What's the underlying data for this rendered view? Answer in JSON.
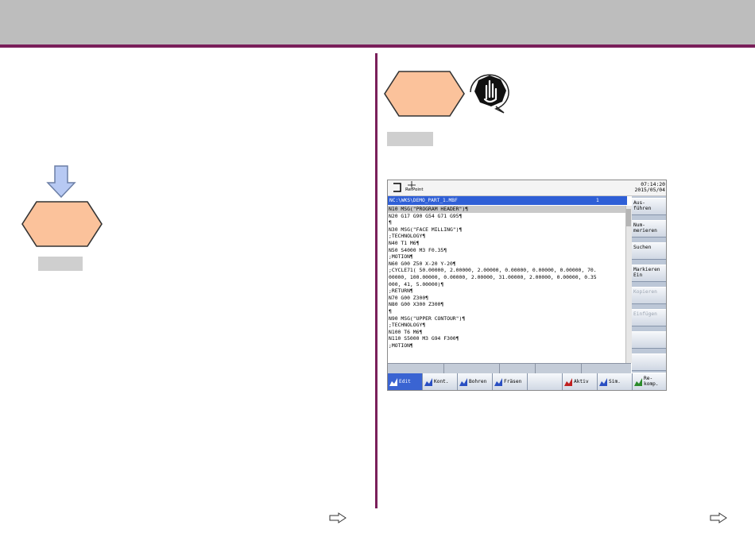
{
  "colors": {
    "header_bar": "#bdbdbd",
    "accent_line": "#7a1f5a",
    "hexagon_fill": "#fbc29b",
    "arrow_fill": "#b7c9f3",
    "gray_box": "#cfcfcf",
    "selection_blue": "#2f5fd6"
  },
  "icons": {
    "down_arrow": "down-arrow-icon",
    "hexagon_left": "hexagon-icon",
    "hexagon_right": "hexagon-icon",
    "warning": "pointing-hand-warning-icon",
    "next_page_left": "right-arrow-icon",
    "next_page_right": "right-arrow-icon"
  },
  "cnc": {
    "time": "07:14:20",
    "date": "2015/05/04",
    "refpoint": "RefPoint",
    "path": "NC:\\WKS\\DEMO_PART_1.MBF",
    "path_num": "1",
    "code_lines": [
      "N10 MSG(\"PROGRAM HEADER\")¶",
      "N20 G17 G90 G54 G71 G95¶",
      "¶",
      "N30 MSG(\"FACE MILLING\")¶",
      ";TECHNOLOGY¶",
      "N40 T1 M6¶",
      "N50 S4000 M3 F0.35¶",
      ";MOTION¶",
      "N60 G00 Z50 X-20 Y-20¶",
      ";CYCLE71( 50.00000, 2.00000, 2.00000, 0.00000, 0.00000, 0.00000, 70.",
      "00000, 100.00000, 0.00000, 2.00000, 31.00000, 2.00000, 0.00000, 0.35",
      "000, 41, 5.00000)¶",
      ";RETURN¶",
      "N70 G00 Z300¶",
      "N80 G00 X300 Z300¶",
      "¶",
      "N90 MSG(\"UPPER CONTOUR\")¶",
      ";TECHNOLOGY¶",
      "N100 T6 M6¶",
      "N110 S5000 M3 G94 F300¶",
      ";MOTION¶"
    ],
    "vertical_softkeys": [
      {
        "label": "Aus-\nführen",
        "enabled": true
      },
      {
        "label": "Num-\nmerieren",
        "enabled": true
      },
      {
        "label": "Suchen",
        "enabled": true
      },
      {
        "label": "Markieren\nEin",
        "enabled": true
      },
      {
        "label": "Kopieren",
        "enabled": false
      },
      {
        "label": "Einfügen",
        "enabled": false
      },
      {
        "label": "",
        "enabled": true
      },
      {
        "label": "",
        "enabled": true
      }
    ],
    "horizontal_softkeys": [
      {
        "label": "Edit",
        "active": true,
        "icon": "edit-icon"
      },
      {
        "label": "Kont.",
        "active": false,
        "icon": "contour-icon"
      },
      {
        "label": "Bohren",
        "active": false,
        "icon": "drill-icon"
      },
      {
        "label": "Fräsen",
        "active": false,
        "icon": "mill-icon"
      },
      {
        "label": "",
        "active": false,
        "icon": ""
      },
      {
        "label": "Aktiv",
        "active": false,
        "icon": "active-icon"
      },
      {
        "label": "Sim.",
        "active": false,
        "icon": "simulation-icon"
      },
      {
        "label": "Re-\nkomp.",
        "active": false,
        "icon": "recompile-icon"
      }
    ]
  }
}
